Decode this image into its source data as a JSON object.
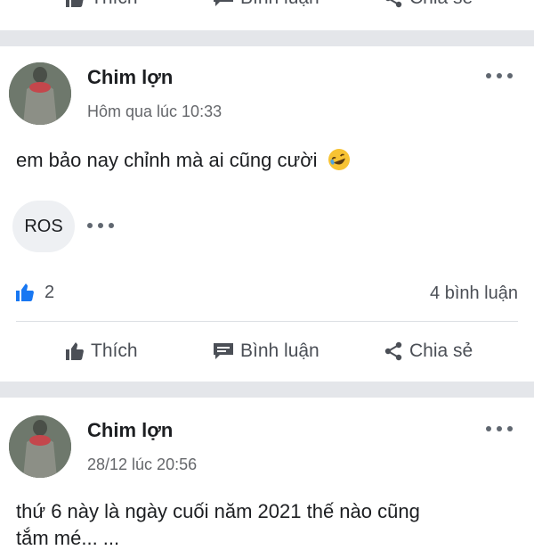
{
  "actions": {
    "like": "Thích",
    "comment": "Bình luận",
    "share": "Chia sẻ"
  },
  "posts": [
    {
      "author": "Chim lợn",
      "time": "Hôm qua lúc 10:33",
      "text": "em bảo nay chỉnh mà ai cũng cười",
      "tag": "ROS",
      "like_count": "2",
      "comments": "4 bình luận"
    },
    {
      "author": "Chim lợn",
      "time": "28/12 lúc 20:56",
      "text_line1": "thứ 6 này là ngày cuối năm 2021 thế nào cũng",
      "text_line2": "tắm mé... ..."
    }
  ],
  "icons": {
    "like": "thumbs-up-icon",
    "comment": "speech-bubble-icon",
    "share": "share-icon",
    "emoji": "laughing-emoji-icon",
    "more": "more-dots-icon"
  },
  "colors": {
    "accent_blue": "#1877f2",
    "divider": "#e4e6ea",
    "muted_text": "#65676b"
  }
}
